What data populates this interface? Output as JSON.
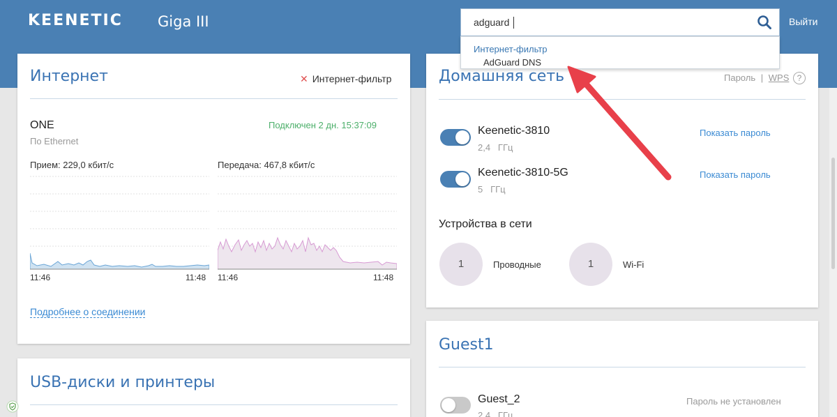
{
  "header": {
    "logo": "KEENETIC",
    "model": "Giga III",
    "logout_label": "Выйти",
    "search": {
      "value": "adguard"
    }
  },
  "search_dropdown": {
    "group_label": "Интернет-фильтр",
    "item_label": "AdGuard DNS"
  },
  "internet": {
    "title": "Интернет",
    "filter_label": "Интернет-фильтр",
    "connection_name": "ONE",
    "connection_type": "По Ethernet",
    "status": "Подключен 2 дн. 15:37:09",
    "receive_label": "Прием: 229,0 кбит/с",
    "transmit_label": "Передача: 467,8 кбит/с",
    "receive_time_start": "11:46",
    "receive_time_end": "11:48",
    "transmit_time_start": "11:46",
    "transmit_time_end": "11:48",
    "details_link": "Подробнее о соединении",
    "colors": {
      "receive": "#a9cde8",
      "transmit": "#e4d6e8"
    }
  },
  "usb": {
    "title": "USB-диски и принтеры"
  },
  "home_network": {
    "title": "Домашняя сеть",
    "password_label": "Пароль",
    "separator": "|",
    "wps_label": "WPS",
    "help_symbol": "?",
    "networks": [
      {
        "name": "Keenetic-3810",
        "band": "2,4",
        "unit": "ГГц",
        "action": "Показать пароль",
        "enabled": true
      },
      {
        "name": "Keenetic-3810-5G",
        "band": "5",
        "unit": "ГГц",
        "action": "Показать пароль",
        "enabled": true
      }
    ],
    "devices_title": "Устройства в сети",
    "wired_count": "1",
    "wired_label": "Проводные",
    "wifi_count": "1",
    "wifi_label": "Wi-Fi"
  },
  "guest": {
    "title": "Guest1",
    "network": {
      "name": "Guest_2",
      "band": "2,4",
      "unit": "ГГц",
      "status": "Пароль не установлен",
      "enabled": false
    }
  },
  "colors": {
    "header": "#4a80b4",
    "accent": "#3a73b3",
    "arrow": "#e8404a",
    "connected": "#4caf6a"
  }
}
